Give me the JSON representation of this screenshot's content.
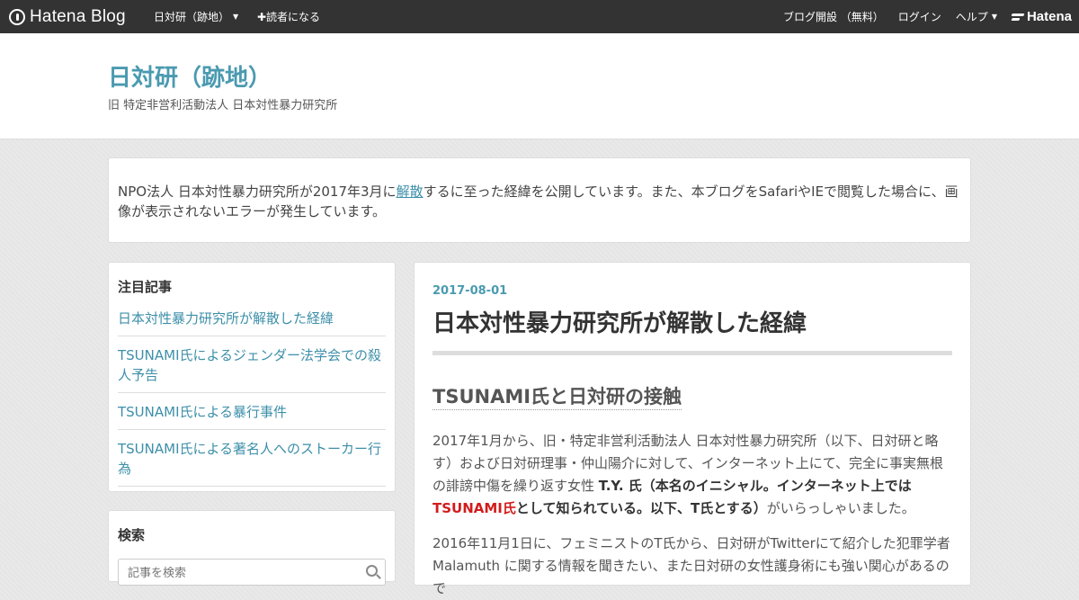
{
  "topbar": {
    "brand": "Hatena Blog",
    "blog_menu": "日対研（跡地）",
    "subscribe": "✚読者になる",
    "create_blog": "ブログ開設 （無料）",
    "login": "ログイン",
    "help": "ヘルプ",
    "hatena": "Hatena"
  },
  "header": {
    "title": "日対研（跡地）",
    "description": "旧 特定非営利活動法人 日本対性暴力研究所"
  },
  "notice": {
    "before": "NPO法人 日本対性暴力研究所が2017年3月に",
    "link": "解散",
    "after": "するに至った経緯を公開しています。また、本ブログをSafariやIEで閲覧した場合に、画像が表示されないエラーが発生しています。"
  },
  "sidebar": {
    "featured_title": "注目記事",
    "featured": [
      "日本対性暴力研究所が解散した経緯",
      "TSUNAMI氏によるジェンダー法学会での殺人予告",
      "TSUNAMI氏による暴行事件",
      "TSUNAMI氏による著名人へのストーカー行為"
    ],
    "search_title": "検索",
    "search_placeholder": "記事を検索"
  },
  "article": {
    "date": "2017-08-01",
    "title": "日本対性暴力研究所が解散した経緯",
    "section": "TSUNAMI氏と日対研の接触",
    "p1_a": "2017年1月から、旧・特定非営利活動法人 日本対性暴力研究所（以下、日対研と略す）および日対研理事・仲山陽介に対して、インターネット上にて、完全に事実無根の誹謗中傷を繰り返す女性 ",
    "p1_bold1": "T.Y. 氏（本名のイニシャル。インターネット上では",
    "p1_red": "TSUNAMI氏",
    "p1_bold2": "として知られている。以下、T氏とする）",
    "p1_c": "がいらっしゃいました。",
    "p2": "2016年11月1日に、フェミニストのT氏から、日対研がTwitterにて紹介した犯罪学者 Malamuth に関する情報を聞きたい、また日対研の女性護身術にも強い関心があるので"
  }
}
